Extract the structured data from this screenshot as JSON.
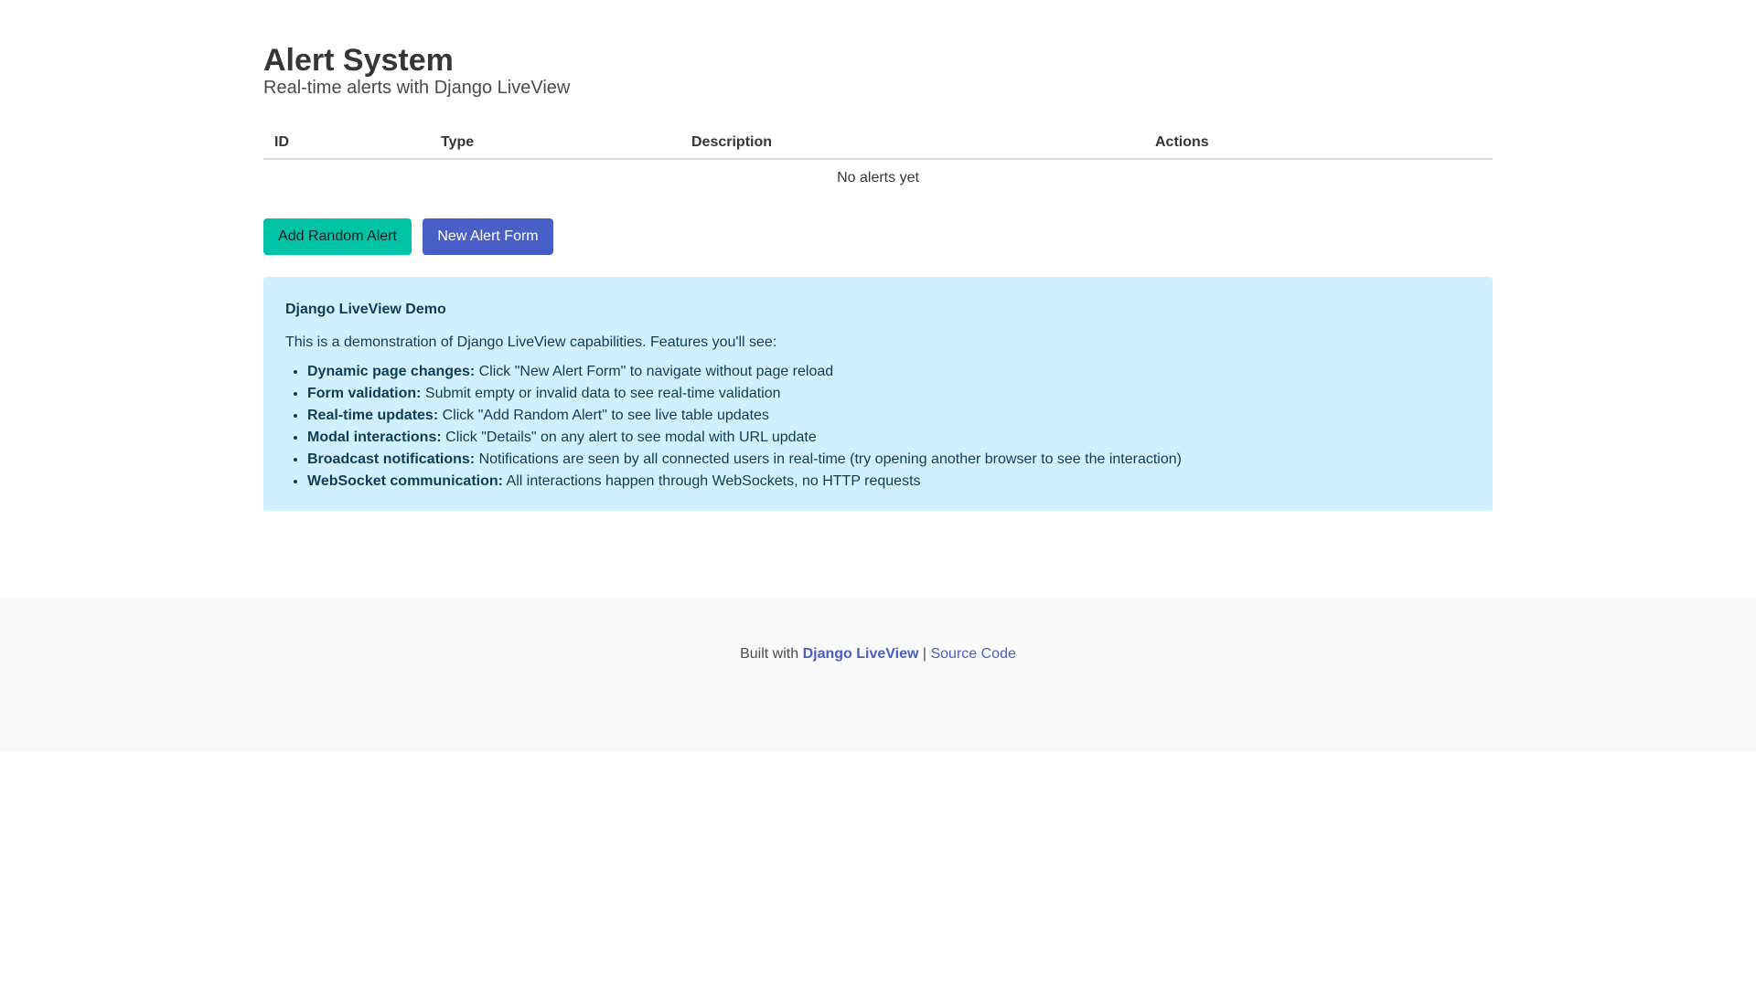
{
  "header": {
    "title": "Alert System",
    "subtitle": "Real-time alerts with Django LiveView"
  },
  "table": {
    "columns": [
      "ID",
      "Type",
      "Description",
      "Actions"
    ],
    "empty_message": "No alerts yet"
  },
  "actions": {
    "add_random_label": "Add Random Alert",
    "new_form_label": "New Alert Form"
  },
  "info": {
    "title": "Django LiveView Demo",
    "intro": "This is a demonstration of Django LiveView capabilities. Features you'll see:",
    "features": [
      {
        "label": "Dynamic page changes:",
        "text": " Click \"New Alert Form\" to navigate without page reload"
      },
      {
        "label": "Form validation:",
        "text": " Submit empty or invalid data to see real-time validation"
      },
      {
        "label": "Real-time updates:",
        "text": " Click \"Add Random Alert\" to see live table updates"
      },
      {
        "label": "Modal interactions:",
        "text": " Click \"Details\" on any alert to see modal with URL update"
      },
      {
        "label": "Broadcast notifications:",
        "text": " Notifications are seen by all connected users in real-time (try opening another browser to see the interaction)"
      },
      {
        "label": "WebSocket communication:",
        "text": " All interactions happen through WebSockets, no HTTP requests"
      }
    ]
  },
  "footer": {
    "built_with": "Built with ",
    "liveview_link": "Django LiveView",
    "separator": " | ",
    "source_link": "Source Code"
  },
  "colors": {
    "primary": "#00c4a7",
    "link": "#485fc7",
    "info_bg": "#cff0fc",
    "info_text": "#103d52"
  }
}
